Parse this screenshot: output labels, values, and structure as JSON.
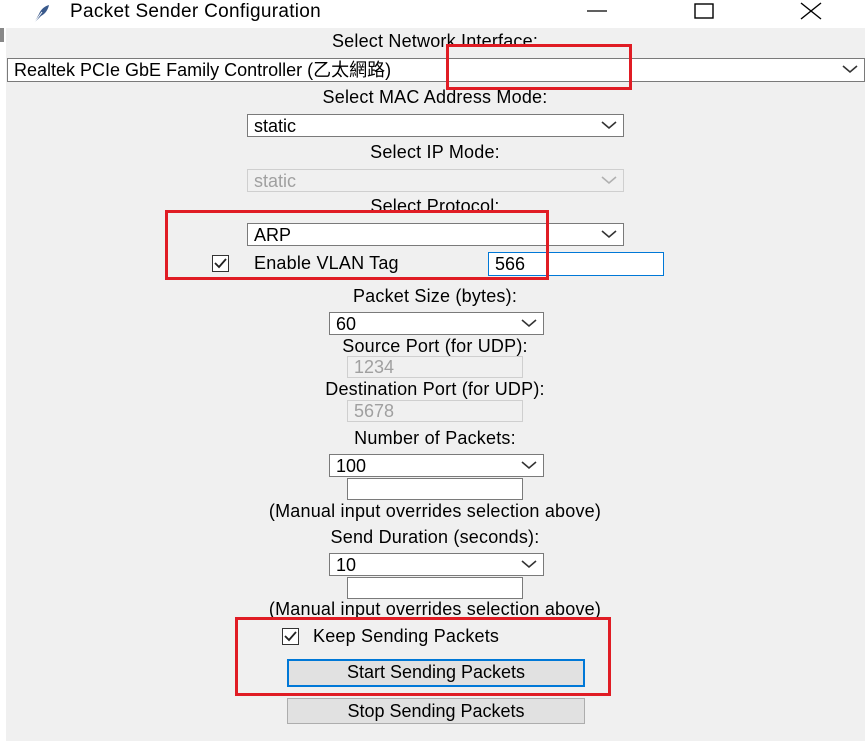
{
  "window": {
    "title": "Packet Sender Configuration",
    "minimize_glyph": "minimize-icon",
    "maximize_glyph": "maximize-icon",
    "close_glyph": "close-icon"
  },
  "form": {
    "network_interface_label": "Select Network Interface:",
    "network_interface_value": "Realtek PCIe GbE Family Controller (乙太網路)",
    "mac_mode_label": "Select MAC Address Mode:",
    "mac_mode_value": "static",
    "ip_mode_label": "Select IP Mode:",
    "ip_mode_value": "static",
    "protocol_label": "Select Protocol:",
    "protocol_value": "ARP",
    "vlan_label": "Enable VLAN Tag",
    "vlan_checked": true,
    "vlan_value": "566",
    "packet_size_label": "Packet Size (bytes):",
    "packet_size_value": "60",
    "source_port_label": "Source Port (for UDP):",
    "source_port_value": "1234",
    "dest_port_label": "Destination Port (for UDP):",
    "dest_port_value": "5678",
    "num_packets_label": "Number of Packets:",
    "num_packets_value": "100",
    "num_packets_manual_value": "",
    "num_packets_note": "(Manual input overrides selection above)",
    "duration_label": "Send Duration (seconds):",
    "duration_value": "10",
    "duration_manual_value": "",
    "duration_note": "(Manual input overrides selection above)",
    "keep_sending_label": "Keep Sending Packets",
    "keep_sending_checked": true,
    "start_button": "Start Sending Packets",
    "stop_button": "Stop Sending Packets"
  },
  "colors": {
    "highlight": "#e01c24",
    "focus": "#0078d7",
    "background": "#f0f0f0"
  }
}
